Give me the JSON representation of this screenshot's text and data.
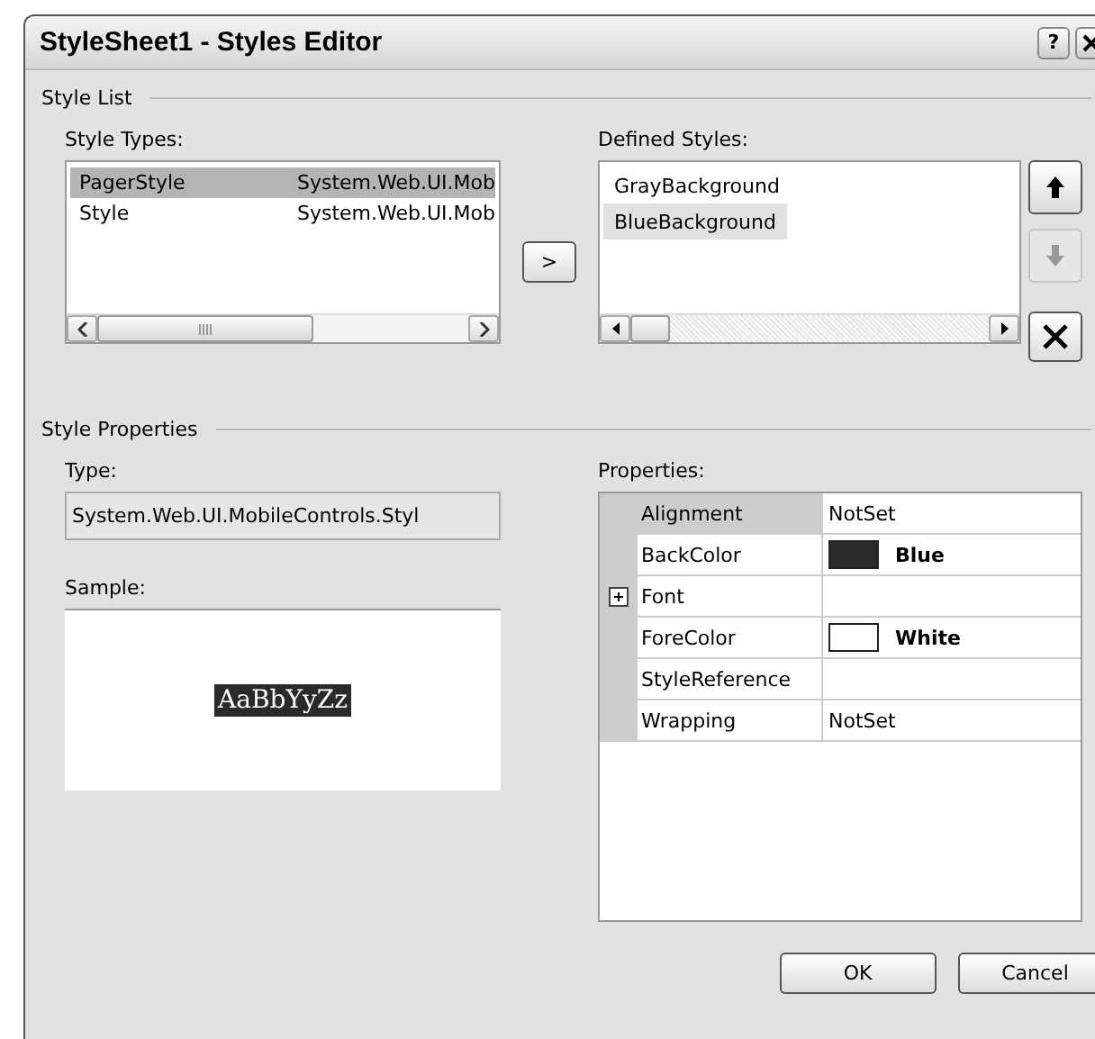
{
  "window": {
    "title": "StyleSheet1 - Styles Editor",
    "help_button": "?"
  },
  "style_list": {
    "heading": "Style List",
    "style_types": {
      "label": "Style Types:",
      "items": [
        {
          "name": "PagerStyle",
          "type": "System.Web.UI.Mob",
          "selected": true
        },
        {
          "name": "Style",
          "type": "System.Web.UI.Mob",
          "selected": false
        }
      ]
    },
    "add_button": ">",
    "defined_styles": {
      "label": "Defined Styles:",
      "items": [
        {
          "name": "GrayBackground",
          "selected": false
        },
        {
          "name": "BlueBackground",
          "selected": true
        }
      ]
    },
    "move_up": {
      "disabled": false
    },
    "move_down": {
      "disabled": true
    },
    "delete": {
      "disabled": false
    }
  },
  "style_properties": {
    "heading": "Style Properties",
    "type_label": "Type:",
    "type_value": "System.Web.UI.MobileControls.Styl",
    "sample_label": "Sample:",
    "sample_text": "AaBbYyZz",
    "properties_label": "Properties:",
    "properties": [
      {
        "name": "Alignment",
        "value": "NotSet",
        "selected": true,
        "expandable": false
      },
      {
        "name": "BackColor",
        "value": "Blue",
        "color": "#2a2a2a",
        "selected": false,
        "expandable": false
      },
      {
        "name": "Font",
        "selected": false,
        "expandable": true
      },
      {
        "name": "ForeColor",
        "value": "White",
        "color": "#ffffff",
        "selected": false,
        "expandable": false
      },
      {
        "name": "StyleReference",
        "selected": false,
        "expandable": false
      },
      {
        "name": "Wrapping",
        "value": "NotSet",
        "selected": false,
        "expandable": false
      }
    ]
  },
  "buttons": [
    "OK",
    "Cancel"
  ]
}
